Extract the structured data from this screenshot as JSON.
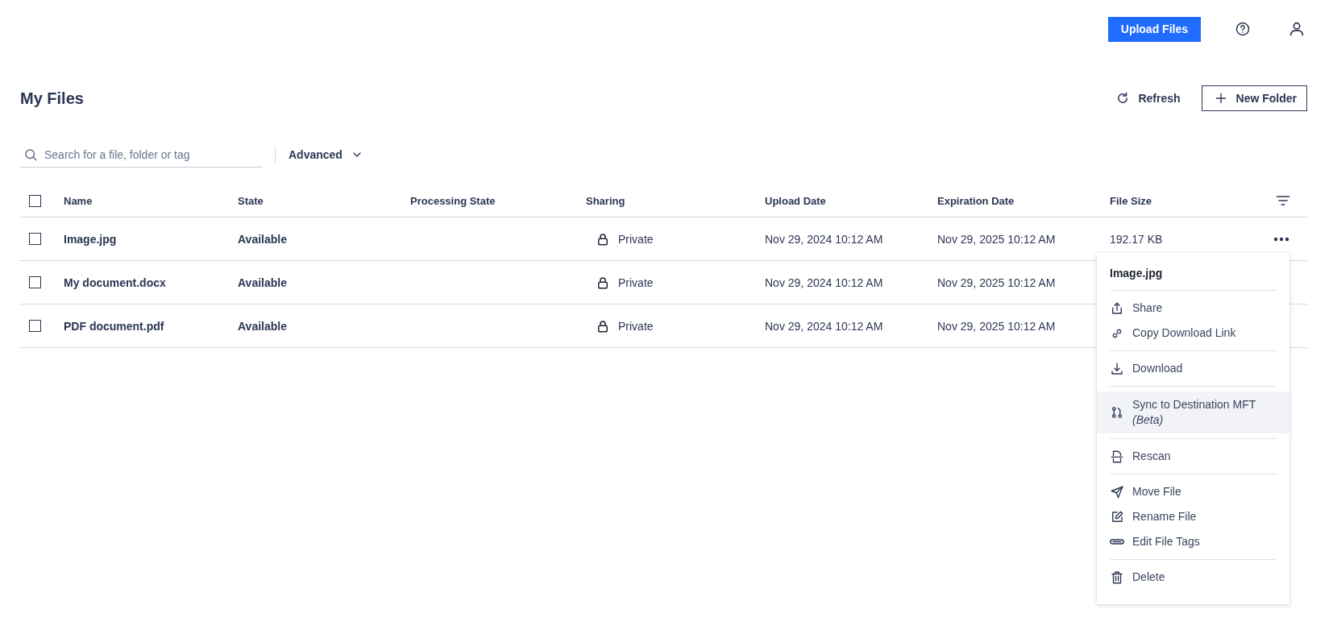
{
  "header": {
    "upload_button": "Upload Files"
  },
  "page": {
    "title": "My Files",
    "refresh": "Refresh",
    "new_folder": "New Folder"
  },
  "search": {
    "placeholder": "Search for a file, folder or tag"
  },
  "advanced": "Advanced",
  "table": {
    "select_all_checked": false,
    "columns": [
      "Name",
      "State",
      "Processing State",
      "Sharing",
      "Upload Date",
      "Expiration Date",
      "File Size"
    ],
    "rows": [
      {
        "checked": false,
        "name": "Image.jpg",
        "state": "Available",
        "sharing": "Private",
        "upload_date": "Nov 29, 2024 10:12 AM",
        "expiration_date": "Nov 29, 2025 10:12 AM",
        "file_size": "192.17 KB",
        "menu_open": true
      },
      {
        "checked": false,
        "name": "My document.docx",
        "state": "Available",
        "sharing": "Private",
        "upload_date": "Nov 29, 2024 10:12 AM",
        "expiration_date": "Nov 29, 2025 10:12 AM",
        "menu_open": false
      },
      {
        "checked": false,
        "name": "PDF document.pdf",
        "state": "Available",
        "sharing": "Private",
        "upload_date": "Nov 29, 2024 10:12 AM",
        "expiration_date": "Nov 29, 2025 10:12 AM",
        "menu_open": false
      }
    ]
  },
  "context_menu": {
    "title": "Image.jpg",
    "groups": [
      [
        {
          "kind": "share",
          "label": "Share",
          "hovered": false
        },
        {
          "kind": "link",
          "label": "Copy Download Link",
          "hovered": false
        }
      ],
      [
        {
          "kind": "download",
          "label": "Download",
          "hovered": false
        }
      ],
      [
        {
          "kind": "sync",
          "label": "Sync to Destination MFT",
          "note": "(Beta)",
          "hovered": true
        }
      ],
      [
        {
          "kind": "rescan",
          "label": "Rescan",
          "hovered": false
        }
      ],
      [
        {
          "kind": "move",
          "label": "Move File",
          "hovered": false
        },
        {
          "kind": "rename",
          "label": "Rename File",
          "hovered": false
        },
        {
          "kind": "tags",
          "label": "Edit File Tags",
          "hovered": false
        }
      ],
      [
        {
          "kind": "delete",
          "label": "Delete",
          "hovered": false
        }
      ]
    ]
  }
}
